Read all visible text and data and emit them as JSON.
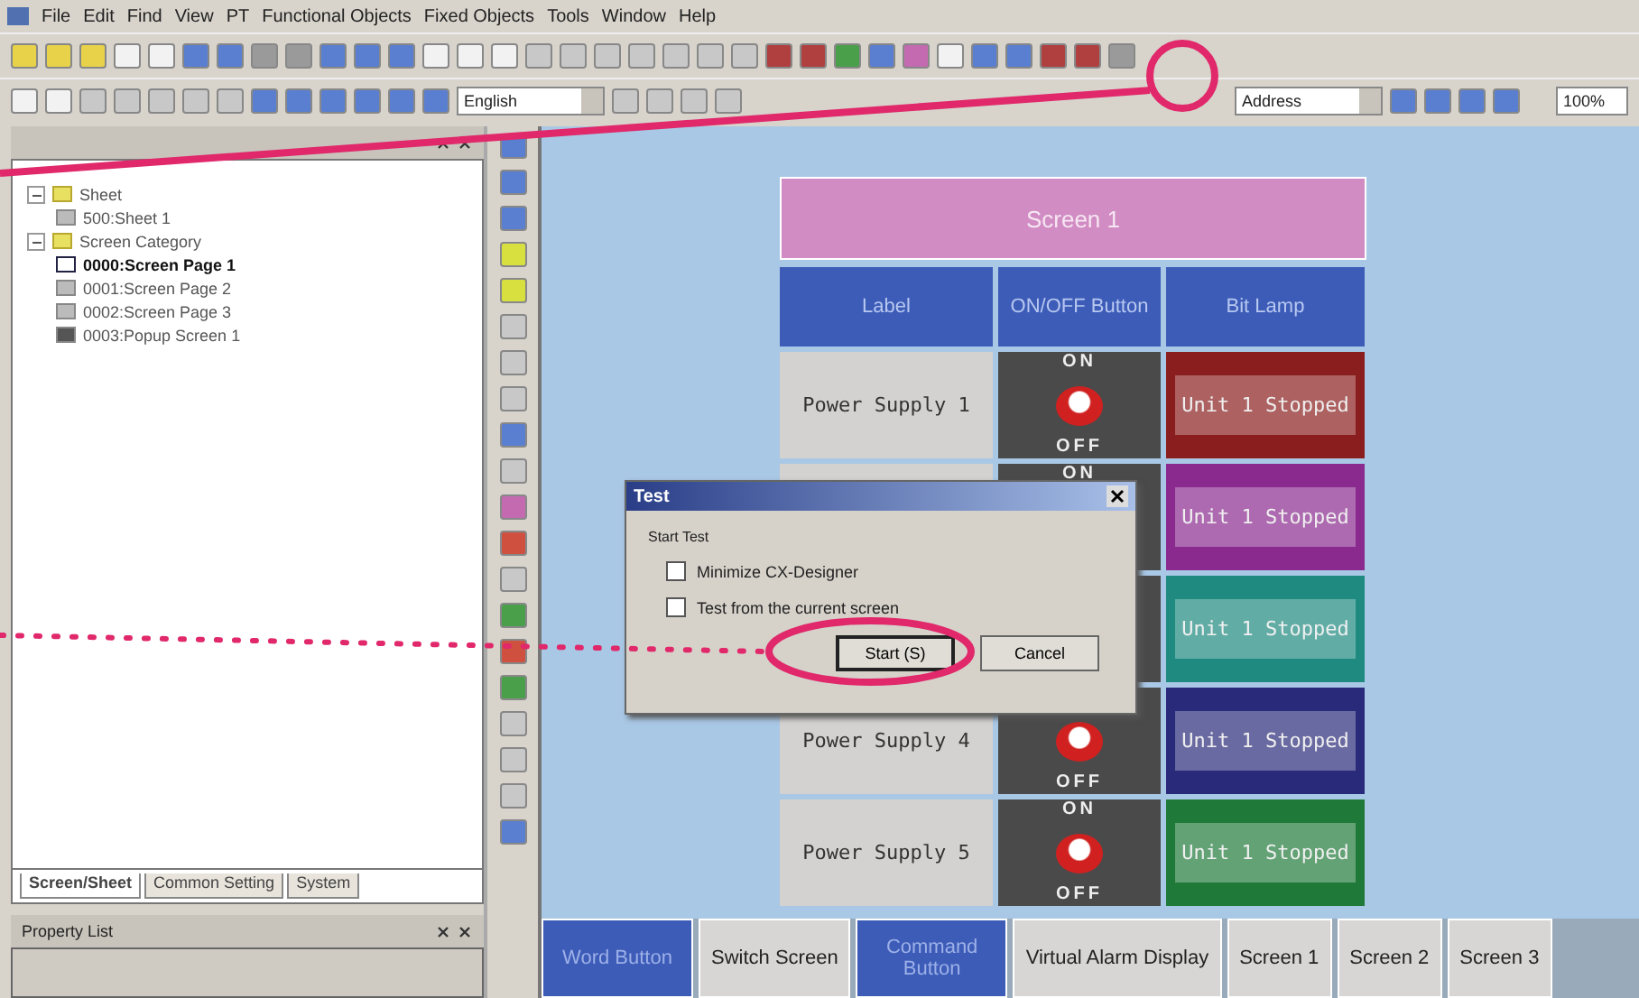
{
  "menu_bar": [
    "File",
    "Edit",
    "Find",
    "View",
    "PT",
    "Functional Objects",
    "Fixed Objects",
    "Tools",
    "Window",
    "Help"
  ],
  "toolbar": {
    "language": "English",
    "address": "Address",
    "zoom": "100%"
  },
  "project_tree": {
    "items": [
      {
        "label": "Sheet",
        "kind": "folder",
        "expanded": true,
        "selected": false,
        "children": [
          {
            "label": "500:Sheet 1",
            "kind": "sheet",
            "selected": false
          }
        ]
      },
      {
        "label": "Screen Category",
        "kind": "folder",
        "expanded": true,
        "selected": false,
        "children": [
          {
            "label": "0000:Screen Page 1",
            "kind": "page",
            "selected": true
          },
          {
            "label": "0001:Screen Page 2",
            "kind": "sheet",
            "selected": false
          },
          {
            "label": "0002:Screen Page 3",
            "kind": "sheet",
            "selected": false
          },
          {
            "label": "0003:Popup Screen 1",
            "kind": "popup",
            "selected": false
          }
        ]
      }
    ]
  },
  "panel_tabs": [
    {
      "label": "Screen/Sheet",
      "selected": true
    },
    {
      "label": "Common Setting",
      "selected": false
    },
    {
      "label": "System",
      "selected": false
    }
  ],
  "property_list": {
    "title": "Property List"
  },
  "screen": {
    "title": "Screen 1",
    "columns": [
      "Label",
      "ON/OFF Button",
      "Bit Lamp"
    ],
    "rows": [
      {
        "label": "Power Supply 1",
        "on": "ON",
        "off": "OFF",
        "lamp": "Unit 1 Stopped",
        "color": "#8a1e1e"
      },
      {
        "on": "ON",
        "lamp": "Unit 1 Stopped",
        "color": "#8a2a8e"
      },
      {
        "lamp": "Unit 1 Stopped",
        "color": "#1e8a80"
      },
      {
        "label": "Power Supply 4",
        "off": "OFF",
        "lamp": "Unit 1 Stopped",
        "color": "#2a2a7a"
      },
      {
        "label": "Power Supply 5",
        "on": "ON",
        "off": "OFF",
        "lamp": "Unit 1 Stopped",
        "color": "#1f7a3a"
      }
    ]
  },
  "bottom_buttons": [
    {
      "label": "Word Button",
      "kind": "filled"
    },
    {
      "label": "Switch Screen",
      "kind": "plain"
    },
    {
      "label": "Command Button",
      "kind": "filled"
    },
    {
      "label": "Virtual Alarm Display",
      "kind": "plain"
    },
    {
      "label": "Screen 1",
      "kind": "plain"
    },
    {
      "label": "Screen 2",
      "kind": "plain"
    },
    {
      "label": "Screen 3",
      "kind": "plain"
    }
  ],
  "dialog": {
    "title": "Test",
    "group": "Start Test",
    "options": [
      {
        "label": "Minimize CX-Designer",
        "checked": false
      },
      {
        "label": "Test from the current screen",
        "checked": false
      }
    ],
    "buttons": [
      "Start (S)",
      "Cancel"
    ]
  }
}
